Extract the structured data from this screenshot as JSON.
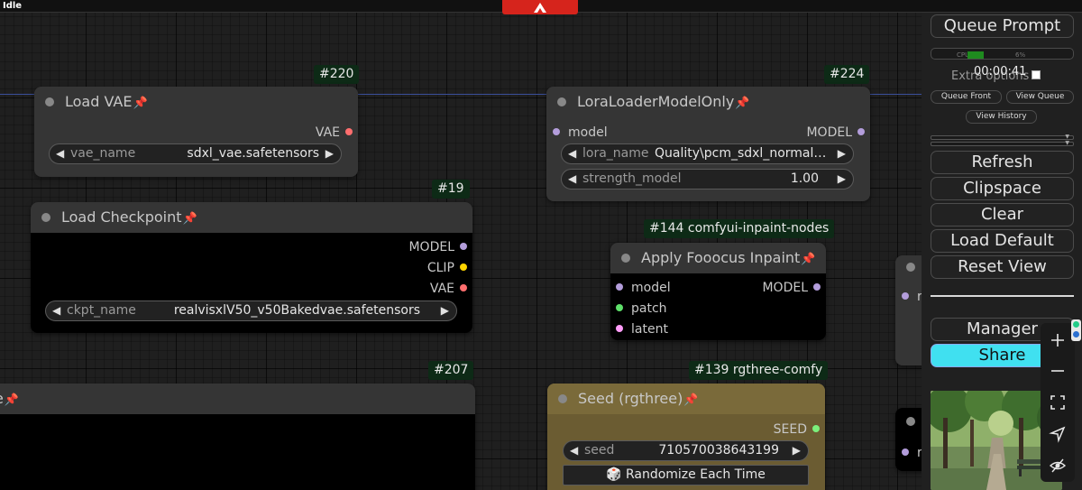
{
  "status": "Idle",
  "badges": {
    "n220": "#220",
    "n224": "#224",
    "n19": "#19",
    "n144": "#144 comfyui-inpaint-nodes",
    "n207": "#207",
    "n139": "#139 rgthree-comfy"
  },
  "nodes": {
    "load_vae": {
      "title": "Load VAE",
      "output": "VAE",
      "widget_name": "vae_name",
      "widget_value": "sdxl_vae.safetensors"
    },
    "lora_loader": {
      "title": "LoraLoaderModelOnly",
      "input": "model",
      "output": "MODEL",
      "widgets": [
        {
          "name": "lora_name",
          "value": "Quality\\pcm_sdxl_normalc..."
        },
        {
          "name": "strength_model",
          "value": "1.00"
        }
      ]
    },
    "load_checkpoint": {
      "title": "Load Checkpoint",
      "outputs": [
        "MODEL",
        "CLIP",
        "VAE"
      ],
      "widget_name": "ckpt_name",
      "widget_value": "realvisxlV50_v50Bakedvae.safetensors"
    },
    "apply_fooocus": {
      "title": "Apply Fooocus Inpaint",
      "inputs": [
        "model",
        "patch",
        "latent"
      ],
      "output": "MODEL"
    },
    "seed": {
      "title": "Seed (rgthree)",
      "output": "SEED",
      "widget_name": "seed",
      "widget_value": "710570038643199",
      "button": "Randomize Each Time"
    },
    "partial_left": {
      "title_fragment": "e"
    },
    "partial_right": {
      "letter": "r"
    }
  },
  "port_colors": {
    "model": "#b39ddb",
    "clip": "#ffd500",
    "vae": "#ff6e6e",
    "patch": "#5ee06a",
    "latent": "#ff9cf9",
    "seed": "#7cf07c"
  },
  "panel": {
    "queue_prompt": "Queue Prompt",
    "cpu_label": "CPU",
    "cpu_value": "6%",
    "timer": "00:00:41",
    "extra_options": "Extra options",
    "queue_front": "Queue Front",
    "view_queue": "View Queue",
    "view_history": "View History",
    "refresh": "Refresh",
    "clipspace": "Clipspace",
    "clear": "Clear",
    "load_default": "Load Default",
    "reset_view": "Reset View",
    "manager": "Manager",
    "share": "Share"
  },
  "toolbar_icons": [
    "plus-icon",
    "minus-icon",
    "fit-view-icon",
    "navigate-icon",
    "hide-icon"
  ],
  "colors": {
    "accent_share": "#40e0f0",
    "logo_red": "#d6241c",
    "seed_node": "#7a6a3a"
  }
}
